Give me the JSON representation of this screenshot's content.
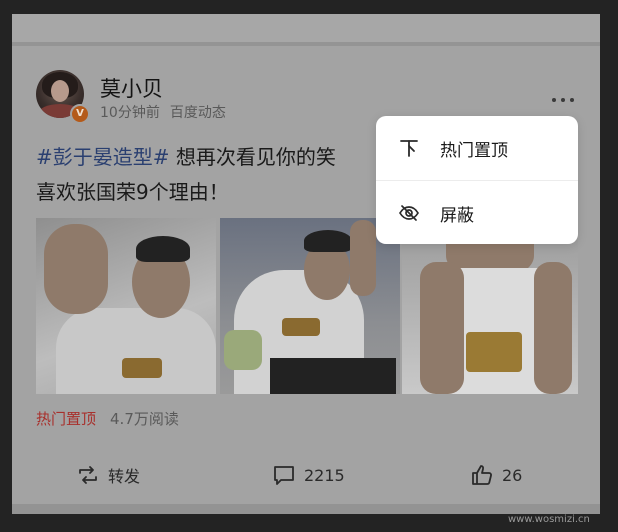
{
  "post": {
    "author": "莫小贝",
    "time": "10分钟前",
    "source": "百度动态",
    "hashtag": "#彭于晏造型#",
    "text_rest": " 想再次看见你的笑",
    "text_line2": "喜欢张国荣9个理由！",
    "stats": {
      "hot_label": "热门置顶",
      "reads": "4.7万阅读"
    },
    "actions": {
      "repost_label": "转发",
      "comment_count": "2215",
      "like_count": "26"
    }
  },
  "menu": {
    "items": [
      {
        "label": "热门置顶",
        "icon": "pin-top-icon"
      },
      {
        "label": "屏蔽",
        "icon": "eye-off-icon"
      }
    ]
  },
  "watermark": "www.wosmizi.cn",
  "colors": {
    "hashtag": "#2a3f70",
    "hot": "#a8302c",
    "overlay_bg": "#a3a3a3",
    "menu_bg": "#ffffff"
  }
}
